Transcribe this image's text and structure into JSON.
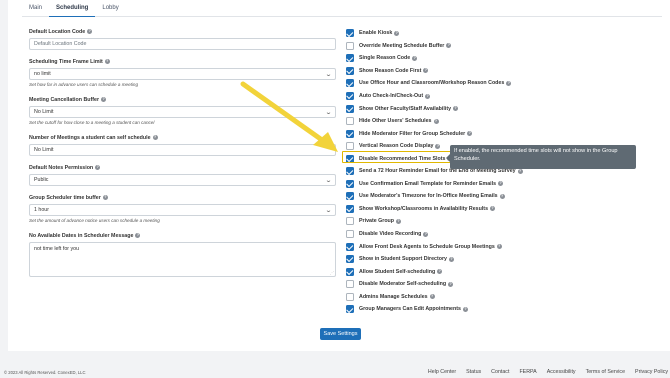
{
  "tabs": [
    "Main",
    "Scheduling",
    "Lobby"
  ],
  "left": {
    "default_location": {
      "label": "Default Location Code",
      "placeholder": "Default Location Code"
    },
    "time_frame": {
      "label": "Scheduling Time Frame Limit",
      "value": "no limit",
      "hint": "Set how far in advance users can schedule a meeting"
    },
    "cancellation": {
      "label": "Meeting Cancellation Buffer",
      "value": "No Limit",
      "hint": "Set the cutoff for how close to a meeting a student can cancel"
    },
    "num_meetings": {
      "label": "Number of Meetings a student can self schedule",
      "value": "No Limit"
    },
    "notes_permission": {
      "label": "Default Notes Permission",
      "value": "Public"
    },
    "group_buffer": {
      "label": "Group Scheduler time buffer",
      "value": "1 hour",
      "hint": "Set the amount of advance notice users can schedule a meeting"
    },
    "no_avail": {
      "label": "No Available Dates in Scheduler Message",
      "value": "not time left for you"
    }
  },
  "checkboxes": [
    {
      "label": "Enable Kiosk",
      "checked": true
    },
    {
      "label": "Override Meeting Schedule Buffer",
      "checked": false
    },
    {
      "label": "Single Reason Code",
      "checked": true
    },
    {
      "label": "Show Reason Code First",
      "checked": true
    },
    {
      "label": "Use Office Hour and Classroom/Workshop Reason Codes",
      "checked": true
    },
    {
      "label": "Auto Check-In/Check-Out",
      "checked": true
    },
    {
      "label": "Show Other Faculty/Staff Availability",
      "checked": true
    },
    {
      "label": "Hide Other Users' Schedules",
      "checked": false
    },
    {
      "label": "Hide Moderator Filter for Group Scheduler",
      "checked": true
    },
    {
      "label": "Vertical Reason Code Display",
      "checked": false
    },
    {
      "label": "Disable Recommended Time Slots",
      "checked": true
    },
    {
      "label": "Send a 72 Hour Reminder Email for the End of Meeting Survey",
      "checked": true
    },
    {
      "label": "Use Confirmation Email Template for Reminder Emails",
      "checked": true
    },
    {
      "label": "Use Moderator's Timezone for In-Office Meeting Emails",
      "checked": true
    },
    {
      "label": "Show Workshop/Classrooms in Availability Results",
      "checked": true
    },
    {
      "label": "Private Group",
      "checked": false
    },
    {
      "label": "Disable Video Recording",
      "checked": false
    },
    {
      "label": "Allow Front Desk Agents to Schedule Group Meetings",
      "checked": true
    },
    {
      "label": "Show in Student Support Directory",
      "checked": true
    },
    {
      "label": "Allow Student Self-scheduling",
      "checked": true
    },
    {
      "label": "Disable Moderator Self-scheduling",
      "checked": false
    },
    {
      "label": "Admins Manage Schedules",
      "checked": false
    },
    {
      "label": "Group Managers Can Edit Appointments",
      "checked": true
    }
  ],
  "tooltip": "If enabled, the recommended time slots will not show in the Group Scheduler.",
  "save_label": "Save Settings",
  "footer": {
    "copyright": "© 2023 All Rights Reserved. ConexED, LLC",
    "links": [
      "Help Center",
      "Status",
      "Contact",
      "FERPA",
      "Accessibility",
      "Terms of Service",
      "Privacy Policy"
    ]
  },
  "colors": {
    "accent": "#1e6fb8",
    "highlight": "#e0b800",
    "arrow": "#f2d33a",
    "tooltip_bg": "#5f6a73"
  }
}
